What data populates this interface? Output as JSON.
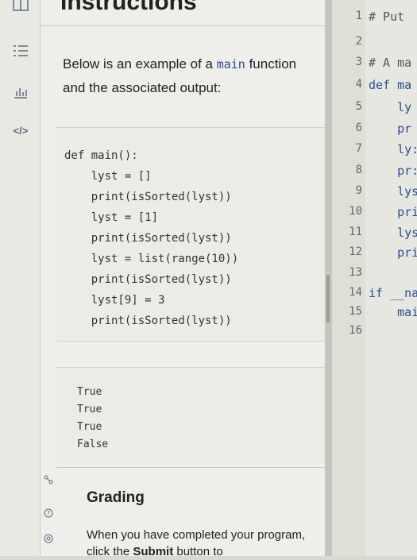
{
  "instructions": {
    "title": "Instructions",
    "intro_before": "Below is an example of a ",
    "intro_code": "main",
    "intro_after": " function and the associated output:",
    "code_lines": [
      "def main():",
      "    lyst = []",
      "    print(isSorted(lyst))",
      "    lyst = [1]",
      "    print(isSorted(lyst))",
      "    lyst = list(range(10))",
      "    print(isSorted(lyst))",
      "    lyst[9] = 3",
      "    print(isSorted(lyst))"
    ],
    "output_lines": [
      "True",
      "True",
      "True",
      "False"
    ],
    "grading_heading": "Grading",
    "grading_text_before": "When you have completed your program, click the ",
    "grading_text_bold": "Submit",
    "grading_text_after": " button to"
  },
  "rail_icons": [
    "list-icon",
    "chart-icon",
    "code-icon"
  ],
  "side_icons": [
    "share-icon",
    "help-icon",
    "settings-icon"
  ],
  "editor": {
    "line_numbers": [
      "1",
      "2",
      "3",
      "4",
      "5",
      "6",
      "7",
      "8",
      "9",
      "10",
      "11",
      "12",
      "13",
      "14",
      "15",
      "16"
    ],
    "lines": [
      "# Put",
      "",
      "# A ma",
      "def ma",
      "    ly",
      "    pr",
      "    ly:",
      "    pr:",
      "    lys",
      "    pri",
      "    lys",
      "    pri",
      "",
      "if __nam",
      "    mair",
      ""
    ]
  }
}
